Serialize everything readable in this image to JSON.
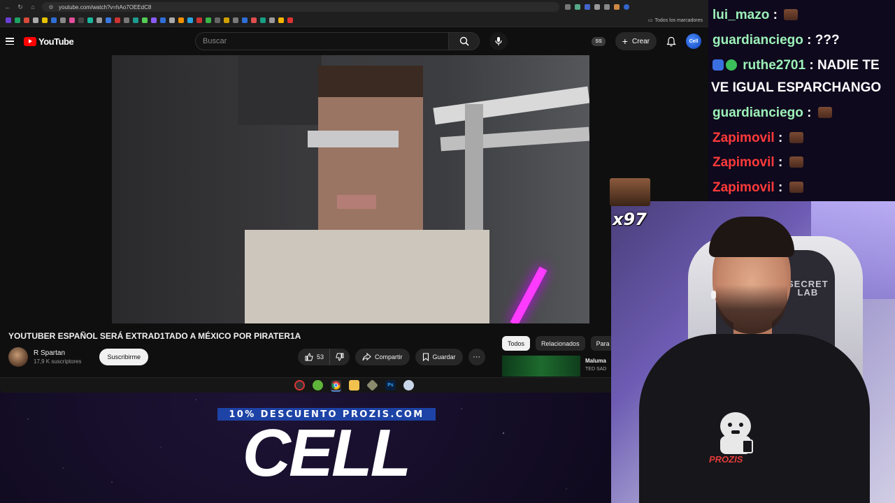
{
  "browser": {
    "url": "youtube.com/watch?v=hAo7OEEdC8",
    "bookmarks_folder": "Todos los marcadores"
  },
  "youtube": {
    "logo_text": "YouTube",
    "search_placeholder": "Buscar",
    "ss_badge": "SS",
    "create_label": "Crear",
    "avatar_label": "Cell",
    "video": {
      "title": "YOUTUBER ESPAÑOL SERÁ EXTRAD1TADO A MÉXICO POR PIRATER1A",
      "channel_name": "R Spartan",
      "subscribers": "17,9 K suscriptores",
      "subscribe_label": "Suscribirme",
      "likes": "53",
      "share_label": "Compartir",
      "save_label": "Guardar",
      "more_label": "···"
    },
    "chips": [
      "Todos",
      "Relacionados",
      "Para"
    ],
    "related": {
      "title": "Maluma",
      "channel": "TED SAD"
    }
  },
  "overlay": {
    "promo_banner": "10% DESCUENTO PROZIS.COM",
    "promo_brand": "CELL",
    "emote_multiplier": "x97",
    "webcam_chair_brand": "SECRET\nLAB",
    "webcam_shirt_brand": "PROZIS"
  },
  "chat": {
    "messages": [
      {
        "user": "lui_mazo",
        "text": ":",
        "user_color": "#9df1b8"
      },
      {
        "user": "guardianciego",
        "text": ": ???",
        "user_color": "#9df1b8"
      },
      {
        "user": "ruthe2701",
        "text": ": NADIE TE",
        "user_color": "#9df1b8"
      },
      {
        "user": "",
        "text": "VE IGUAL ESPARCHANGO",
        "user_color": "#ffffff"
      },
      {
        "user": "guardianciego",
        "text": ":",
        "user_color": "#9df1b8"
      },
      {
        "user": "Zapimovil",
        "text": ":",
        "user_color": "#ff3a3a"
      },
      {
        "user": "Zapimovil",
        "text": ":",
        "user_color": "#ff3a3a"
      },
      {
        "user": "Zapimovil",
        "text": ":",
        "user_color": "#ff3a3a"
      }
    ]
  }
}
